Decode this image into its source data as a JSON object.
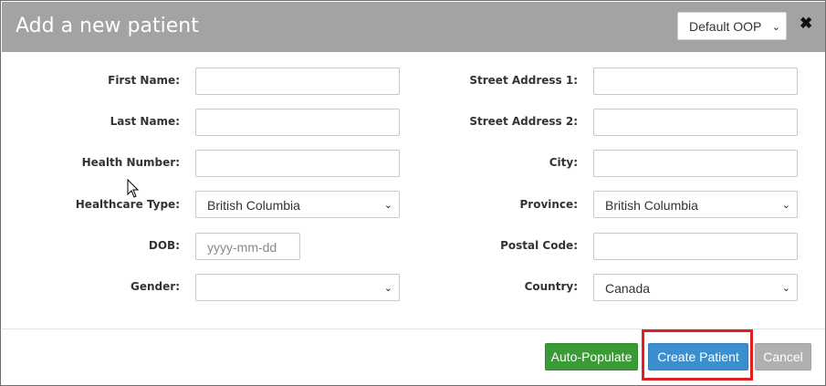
{
  "header": {
    "title": "Add a new patient",
    "oop_selected": "Default OOP",
    "close_symbol": "✖"
  },
  "form_left": {
    "first_name": {
      "label": "First Name:",
      "value": ""
    },
    "last_name": {
      "label": "Last Name:",
      "value": ""
    },
    "health_number": {
      "label": "Health Number:",
      "value": ""
    },
    "healthcare_type": {
      "label": "Healthcare Type:",
      "value": "British Columbia"
    },
    "dob": {
      "label": "DOB:",
      "placeholder": "yyyy-mm-dd"
    },
    "gender": {
      "label": "Gender:",
      "value": ""
    }
  },
  "form_right": {
    "street1": {
      "label": "Street Address 1:",
      "value": ""
    },
    "street2": {
      "label": "Street Address 2:",
      "value": ""
    },
    "city": {
      "label": "City:",
      "value": ""
    },
    "province": {
      "label": "Province:",
      "value": "British Columbia"
    },
    "postal_code": {
      "label": "Postal Code:",
      "value": ""
    },
    "country": {
      "label": "Country:",
      "value": "Canada"
    }
  },
  "footer": {
    "auto_populate": "Auto-Populate",
    "create_patient": "Create Patient",
    "cancel": "Cancel"
  },
  "colors": {
    "header_bg": "#a3a3a3",
    "auto_btn": "#3a9a35",
    "create_btn": "#3b8fce",
    "cancel_btn": "#b0b0b0",
    "highlight": "#e02020"
  }
}
